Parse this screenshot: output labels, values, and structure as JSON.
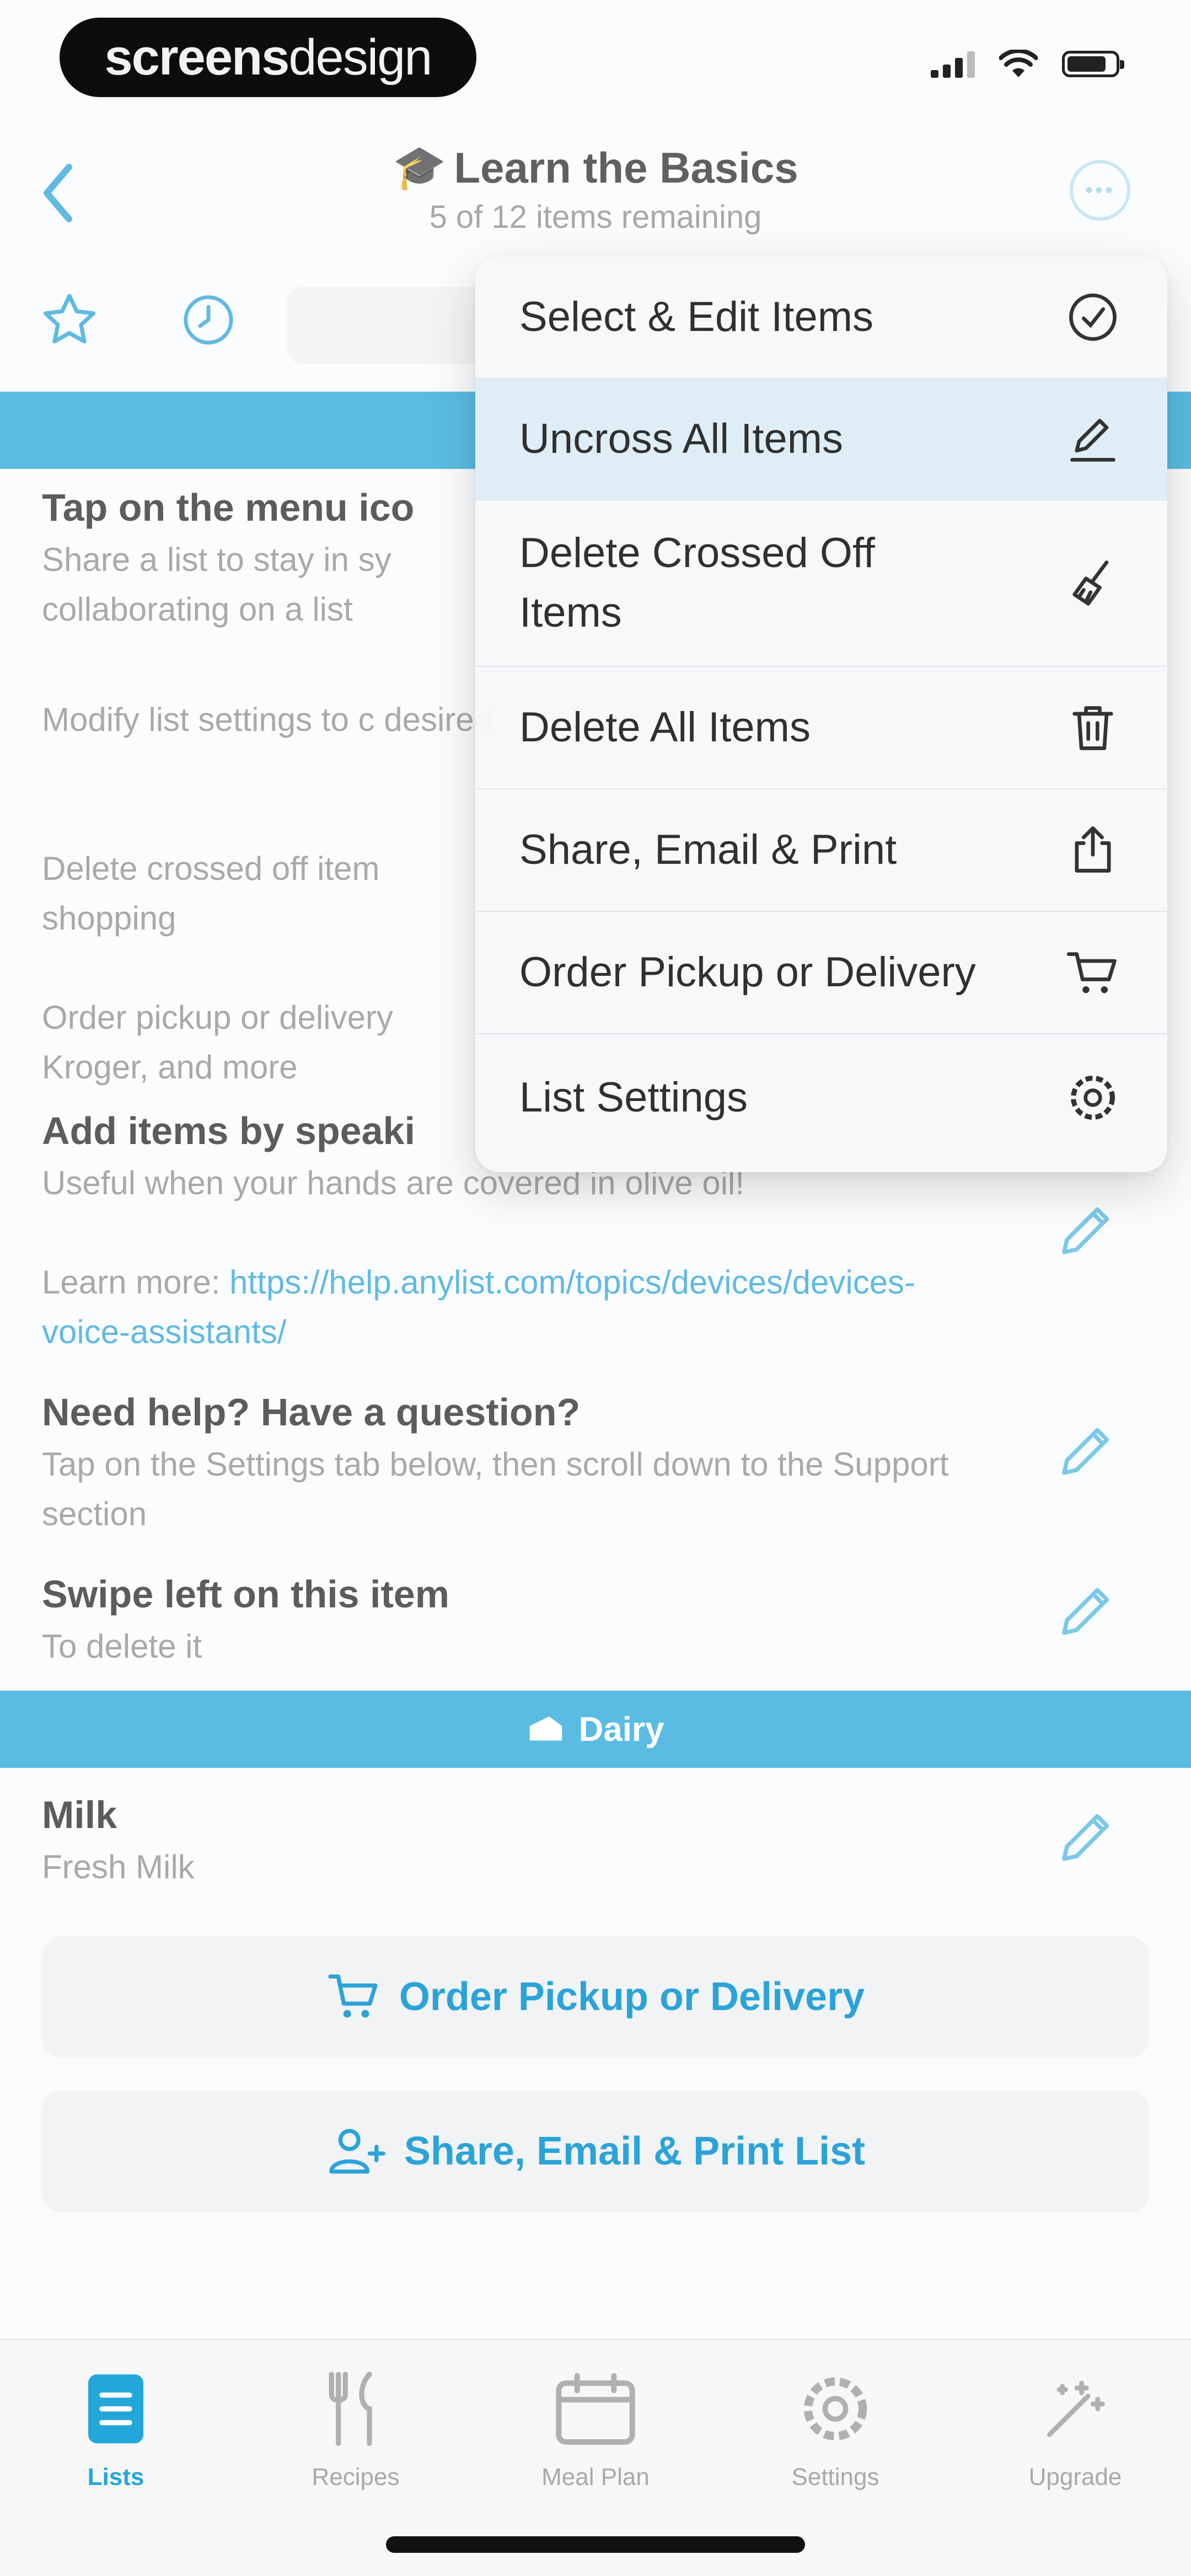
{
  "status_bar": {
    "brand_bold": "screens",
    "brand_light": "design"
  },
  "nav": {
    "title_emoji": "🎓",
    "title": "Learn the Basics",
    "subtitle": "5 of 12 items remaining"
  },
  "menu": {
    "items": [
      {
        "label": "Select & Edit Items",
        "icon": "checkmark-circle-icon"
      },
      {
        "label": "Uncross All Items",
        "icon": "pen-icon"
      },
      {
        "label": "Delete Crossed Off Items",
        "icon": "broom-icon"
      },
      {
        "label": "Delete All Items",
        "icon": "trash-icon"
      },
      {
        "label": "Share, Email & Print",
        "icon": "share-icon"
      },
      {
        "label": "Order Pickup or Delivery",
        "icon": "cart-icon"
      },
      {
        "label": "List Settings",
        "icon": "gear-icon"
      }
    ]
  },
  "list": {
    "items": [
      {
        "title": "Tap on the menu ico",
        "note": "Share a list to stay in sy collaborating on a list"
      },
      {
        "title": "",
        "note": "Modify list settings to c desired"
      },
      {
        "title": "",
        "note": "Delete crossed off item shopping"
      },
      {
        "title": "",
        "note": "Order pickup or delivery Kroger, and more"
      },
      {
        "title": "Add items by speaki",
        "note": "Useful when your hands are covered in olive oil!",
        "note2": "Learn more: ",
        "link": "https://help.anylist.com/topics/devices/devices-voice-assistants/"
      },
      {
        "title": "Need help? Have a question?",
        "note": "Tap on the Settings tab below, then scroll down to the Support section"
      },
      {
        "title": "Swipe left on this item",
        "note": "To delete it"
      }
    ],
    "dairy_category": "Dairy",
    "dairy_items": [
      {
        "title": "Milk",
        "note": "Fresh Milk"
      }
    ]
  },
  "actions": {
    "order": "Order Pickup or Delivery",
    "share": "Share, Email & Print List"
  },
  "tabs": [
    {
      "label": "Lists",
      "icon": "list-icon",
      "active": true
    },
    {
      "label": "Recipes",
      "icon": "fork-knife-icon",
      "active": false
    },
    {
      "label": "Meal Plan",
      "icon": "calendar-icon",
      "active": false
    },
    {
      "label": "Settings",
      "icon": "gear-icon",
      "active": false
    },
    {
      "label": "Upgrade",
      "icon": "magic-wand-icon",
      "active": false
    }
  ],
  "colors": {
    "accent": "#23a6d9",
    "text": "#262626",
    "muted": "#8c8c8c"
  }
}
